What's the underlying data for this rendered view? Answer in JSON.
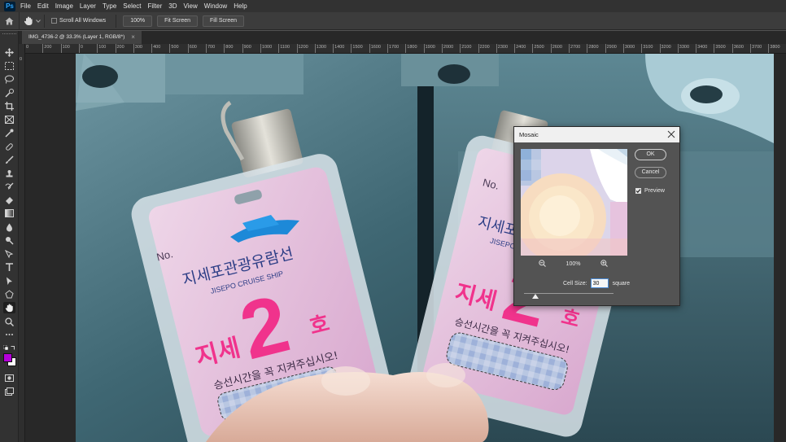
{
  "menubar": {
    "logo": "Ps",
    "items": [
      "File",
      "Edit",
      "Image",
      "Layer",
      "Type",
      "Select",
      "Filter",
      "3D",
      "View",
      "Window",
      "Help"
    ]
  },
  "options": {
    "scroll_all_windows": "Scroll All Windows",
    "zoom_100": "100%",
    "fit_screen": "Fit Screen",
    "fill_screen": "Fill Screen"
  },
  "document": {
    "tab_title": "IMG_4736-2 @ 33.3% (Layer 1, RGB/8*)",
    "tab_close": "×"
  },
  "ruler": {
    "top_labels": [
      "0",
      "200",
      "100",
      "0",
      "100",
      "200",
      "300",
      "400",
      "500",
      "600",
      "700",
      "800",
      "900",
      "1000",
      "1100",
      "1200",
      "1300",
      "1400",
      "1500",
      "1600",
      "1700",
      "1800",
      "1900",
      "2000",
      "2100",
      "2200",
      "2300",
      "2400",
      "2500",
      "2600",
      "2700",
      "2800",
      "2900",
      "3000",
      "3100",
      "3200",
      "3300",
      "3400",
      "3500",
      "3600",
      "3700",
      "3800",
      "3900",
      "4000"
    ],
    "left_label": "0"
  },
  "photo": {
    "badge_no": "No.",
    "badge_title": "지세포관광유람선",
    "badge_subtitle": "JISEPO CRUISE SHIP",
    "badge_prefix": "지세",
    "badge_number": "2",
    "badge_suffix": "호",
    "badge_notice": "승선시간을 꼭 지켜주십시오!"
  },
  "mosaic": {
    "title": "Mosaic",
    "ok": "OK",
    "cancel": "Cancel",
    "preview_label": "Preview",
    "preview_checked": true,
    "zoom": "100%",
    "cell_size_label": "Cell Size:",
    "cell_size_value": "30",
    "cell_size_unit": "square"
  },
  "colors": {
    "foreground": "#b400d8",
    "background": "#ffffff",
    "badge_pink": "#f0338c",
    "badge_bg": "#e7c6df"
  }
}
